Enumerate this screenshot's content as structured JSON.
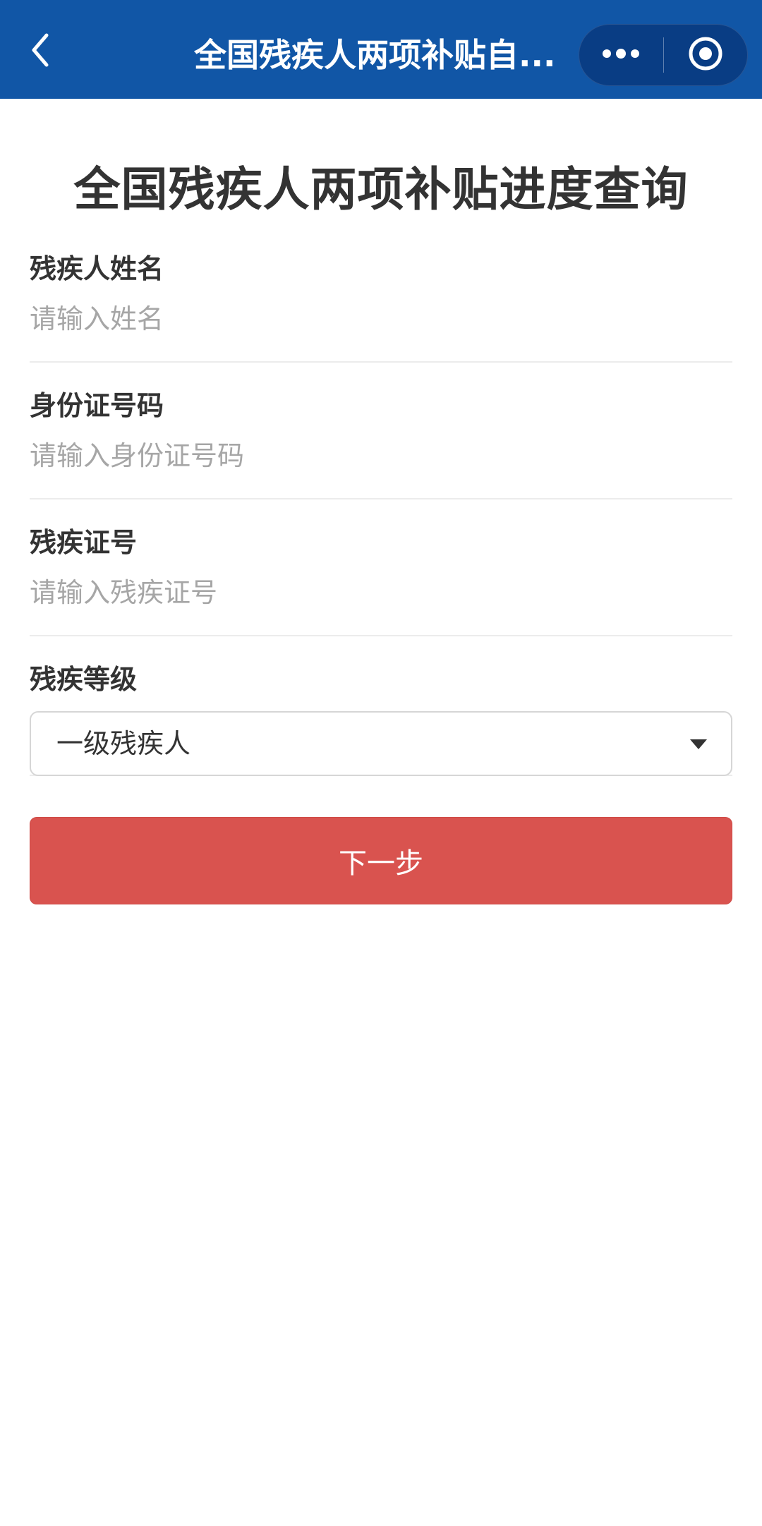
{
  "header": {
    "title": "全国残疾人两项补贴自...",
    "background_color": "#1156a6",
    "back_icon": "chevron-left-icon",
    "more_icon": "more-dots-icon",
    "close_icon": "miniprogram-close-icon"
  },
  "page": {
    "title": "全国残疾人两项补贴进度查询"
  },
  "form": {
    "name": {
      "label": "残疾人姓名",
      "placeholder": "请输入姓名",
      "value": ""
    },
    "id_number": {
      "label": "身份证号码",
      "placeholder": "请输入身份证号码",
      "value": ""
    },
    "disability_certificate": {
      "label": "残疾证号",
      "placeholder": "请输入残疾证号",
      "value": ""
    },
    "disability_level": {
      "label": "残疾等级",
      "selected": "一级残疾人"
    },
    "next_button_label": "下一步",
    "button_color": "#d9534f"
  }
}
